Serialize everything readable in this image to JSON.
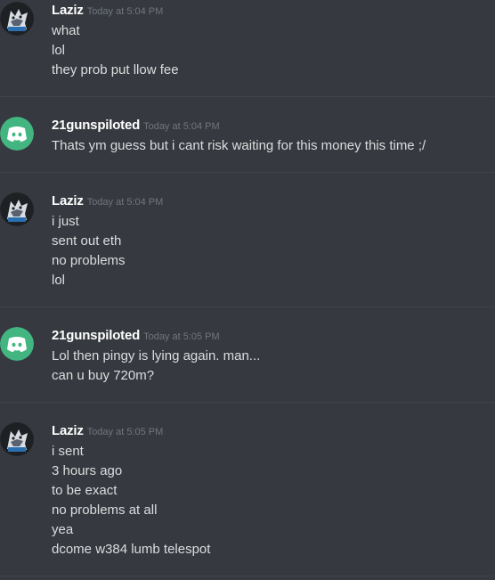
{
  "messages": [
    {
      "author": "Laziz",
      "timestamp": "Today at 5:04 PM",
      "avatar_icon": "laziz-wolf-avatar-icon",
      "lines": [
        "what",
        "lol",
        "they prob put llow fee"
      ]
    },
    {
      "author": "21gunspiloted",
      "timestamp": "Today at 5:04 PM",
      "avatar_icon": "discord-default-avatar-icon",
      "avatar_color": "#43b581",
      "lines": [
        "Thats ym guess but i cant risk waiting for this money this time ;/"
      ]
    },
    {
      "author": "Laziz",
      "timestamp": "Today at 5:04 PM",
      "avatar_icon": "laziz-wolf-avatar-icon",
      "lines": [
        "i just",
        "sent out eth",
        "no problems",
        "lol"
      ]
    },
    {
      "author": "21gunspiloted",
      "timestamp": "Today at 5:05 PM",
      "avatar_icon": "discord-default-avatar-icon",
      "avatar_color": "#43b581",
      "lines": [
        "Lol then pingy is lying again. man...",
        "can u buy 720m?"
      ]
    },
    {
      "author": "Laziz",
      "timestamp": "Today at 5:05 PM",
      "avatar_icon": "laziz-wolf-avatar-icon",
      "lines": [
        "i sent",
        "3 hours ago",
        "to be exact",
        "no problems at all",
        "yea",
        "dcome w384 lumb telespot"
      ]
    }
  ],
  "colors": {
    "background": "#36393f",
    "username": "#ffffff",
    "timestamp": "#72767d",
    "text": "#dcddde",
    "divider": "#40444b",
    "discord_avatar": "#43b581"
  }
}
